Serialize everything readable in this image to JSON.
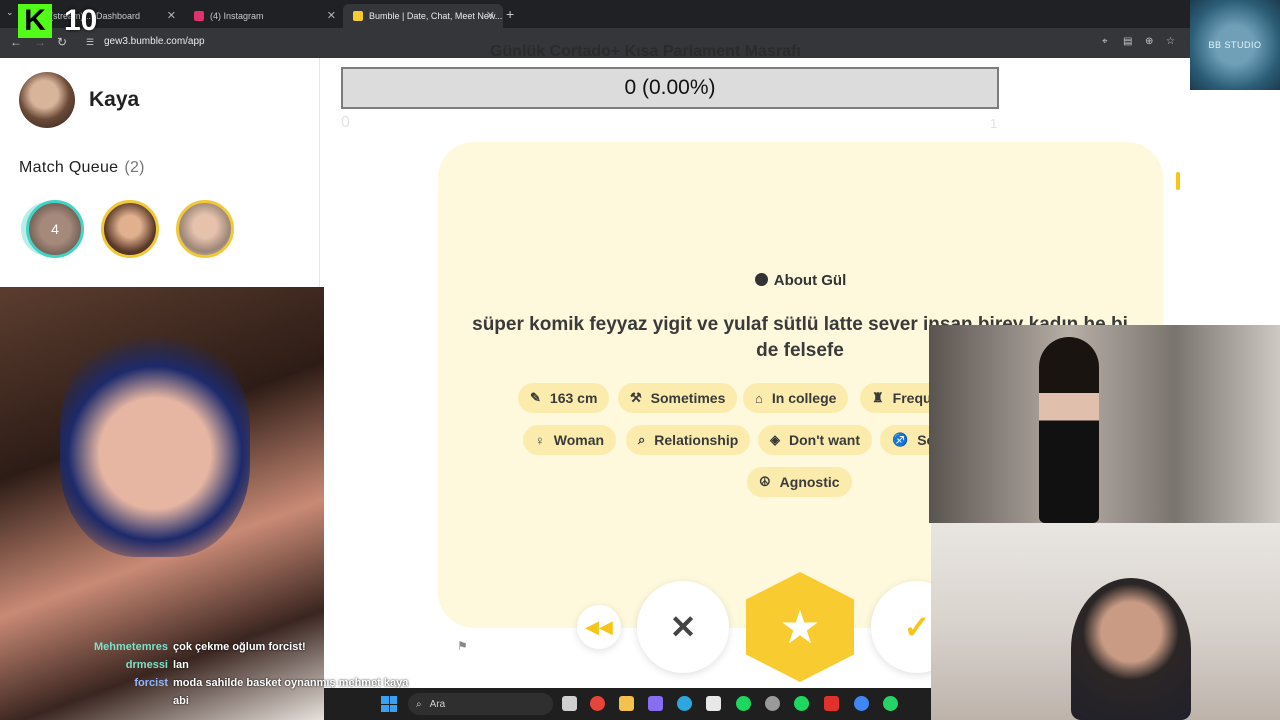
{
  "browser": {
    "tabs": [
      {
        "label": "(stream) ... Dashboard",
        "active": false
      },
      {
        "label": "(4) Instagram",
        "active": false
      },
      {
        "label": "Bumble | Date, Chat, Meet New...",
        "active": true
      }
    ],
    "url": "gew3.bumble.com/app"
  },
  "sidebar": {
    "user_name": "Kaya",
    "match_queue_label": "Match Queue",
    "match_queue_count": "(2)",
    "queue_first_badge": "4"
  },
  "overlay": {
    "title": "Günlük Cortado+ Kısa Parlament Masrafı",
    "progress_value": 0,
    "progress_text": "0 (0.00%)",
    "axis_min": "0",
    "axis_max": "1",
    "brand_badge": "BB STUDIO",
    "kick_number": "10"
  },
  "profile": {
    "about_title": "About Gül",
    "bio": "süper komik feyyaz yigit ve yulaf sütlü latte sever insan birey kadın he bi de felsefe",
    "chips": [
      {
        "icon": "ruler-icon",
        "label": "163 cm"
      },
      {
        "icon": "dumbbell-icon",
        "label": "Sometimes"
      },
      {
        "icon": "graduation-cap-icon",
        "label": "In college"
      },
      {
        "icon": "wine-glass-icon",
        "label": "Frequ"
      },
      {
        "icon": "person-icon",
        "label": "Woman"
      },
      {
        "icon": "magnifier-icon",
        "label": "Relationship"
      },
      {
        "icon": "pacifier-icon",
        "label": "Don't want"
      },
      {
        "icon": "zodiac-icon",
        "label": "Sc"
      },
      {
        "icon": "praying-hands-icon",
        "label": "Agnostic"
      }
    ],
    "accent_color": "#f8cc31"
  },
  "chat": [
    {
      "user": "Mehmetemres",
      "msg": "çok çekme oğlum forcist!"
    },
    {
      "user": "drmessi",
      "msg": "lan"
    },
    {
      "user": "forcist",
      "msg": "moda sahilde basket oynanmış mehmet kaya"
    },
    {
      "user": "",
      "msg": "abi"
    }
  ],
  "taskbar": {
    "search_placeholder": "Ara"
  }
}
